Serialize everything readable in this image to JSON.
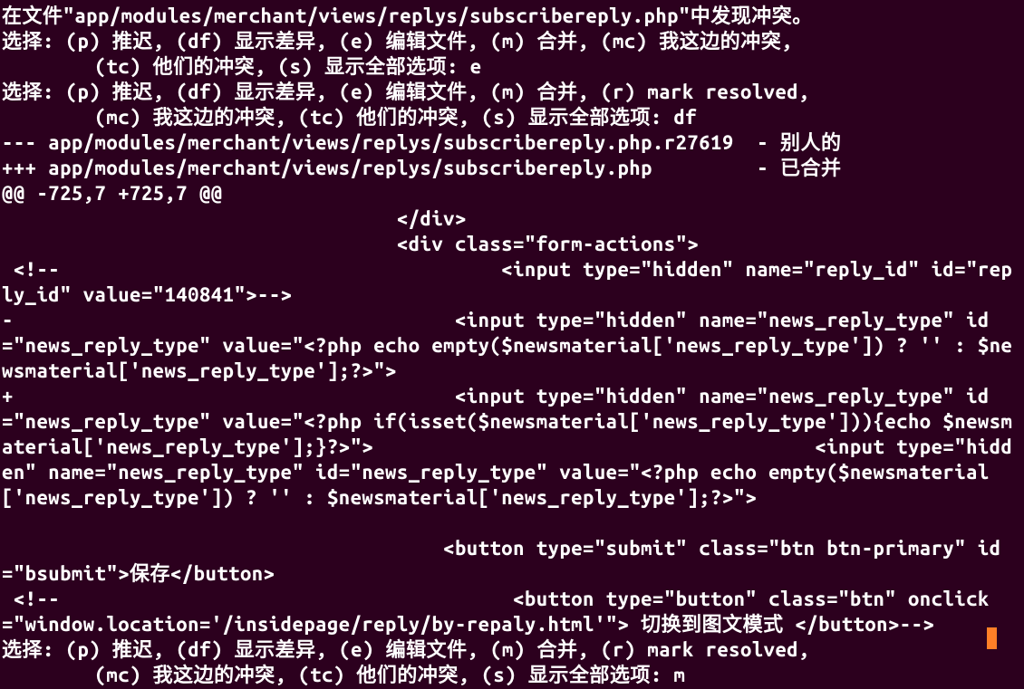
{
  "lines": {
    "l01": "在文件\"app/modules/merchant/views/replys/subscribereply.php\"中发现冲突。",
    "l02": "选择: (p) 推迟, (df) 显示差异, (e) 编辑文件, (m) 合并, (mc) 我这边的冲突,",
    "l03": "        (tc) 他们的冲突, (s) 显示全部选项: e",
    "l04": "选择: (p) 推迟, (df) 显示差异, (e) 编辑文件, (m) 合并, (r) mark resolved,",
    "l05": "        (mc) 我这边的冲突, (tc) 他们的冲突, (s) 显示全部选项: df",
    "l06": "--- app/modules/merchant/views/replys/subscribereply.php.r27619  - 别人的",
    "l07": "+++ app/modules/merchant/views/replys/subscribereply.php         - 已合并",
    "l08": "@@ -725,7 +725,7 @@",
    "l09": "                                  </div>",
    "l10": "                                  <div class=\"form-actions\">",
    "l11": " <!--                                      <input type=\"hidden\" name=\"reply_id\" id=\"reply_id\" value=\"140841\">-->",
    "l12": "-                                      <input type=\"hidden\" name=\"news_reply_type\" id=\"news_reply_type\" value=\"<?php echo empty($newsmaterial['news_reply_type']) ? '' : $newsmaterial['news_reply_type'];?>\">",
    "l13": "+                                      <input type=\"hidden\" name=\"news_reply_type\" id=\"news_reply_type\" value=\"<?php if(isset($newsmaterial['news_reply_type'])){echo $newsmaterial['news_reply_type'];}?>\">                                      <input type=\"hidden\" name=\"news_reply_type\" id=\"news_reply_type\" value=\"<?php echo empty($newsmaterial['news_reply_type']) ? '' : $newsmaterial['news_reply_type'];?>\">",
    "l14": "",
    "l15": "                                      <button type=\"submit\" class=\"btn btn-primary\" id =\"bsubmit\">保存</button>",
    "l16": " <!--                                       <button type=\"button\" class=\"btn\" onclick=\"window.location='/insidepage/reply/by-repaly.html'\"> 切换到图文模式 </button>-->",
    "l17": "选择: (p) 推迟, (df) 显示差异, (e) 编辑文件, (m) 合并, (r) mark resolved,",
    "l18": "        (mc) 我这边的冲突, (tc) 他们的冲突, (s) 显示全部选项: m"
  }
}
